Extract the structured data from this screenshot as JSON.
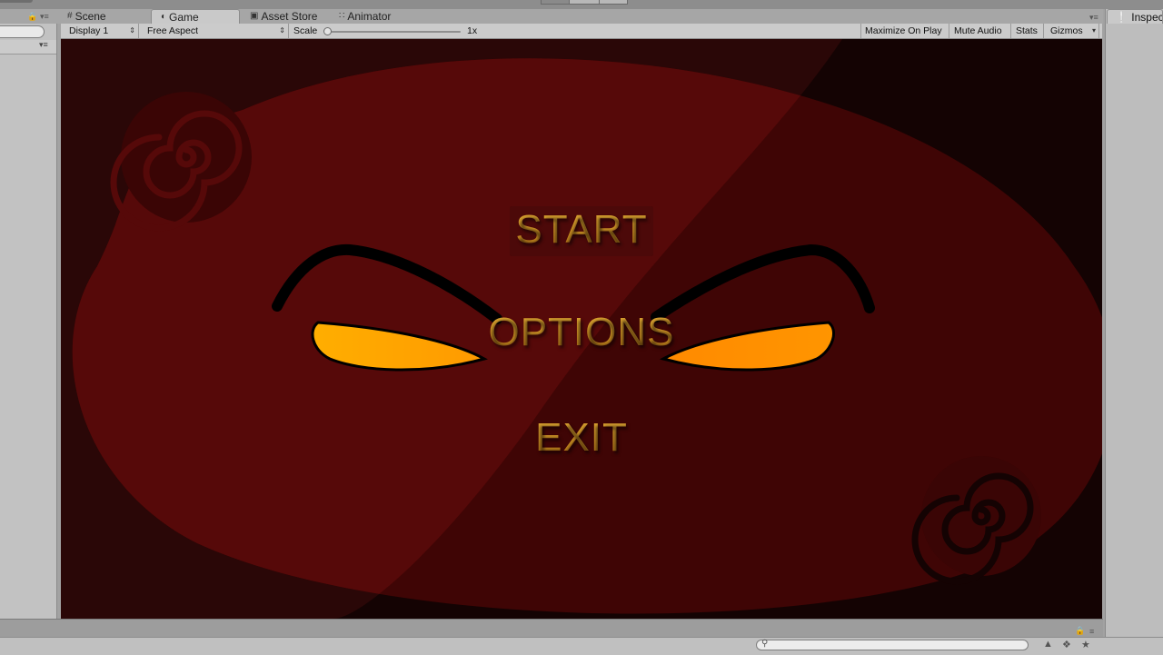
{
  "tabs": [
    {
      "label": "Scene",
      "icon": "grid-icon"
    },
    {
      "label": "Game",
      "icon": "pacman-icon",
      "active": true
    },
    {
      "label": "Asset Store",
      "icon": "store-icon"
    },
    {
      "label": "Animator",
      "icon": "animator-icon"
    }
  ],
  "inspector_tab": "Inspector",
  "toolbar": {
    "display": "Display 1",
    "aspect": "Free Aspect",
    "scale_label": "Scale",
    "scale_value": "1x",
    "maximize": "Maximize On Play",
    "mute": "Mute Audio",
    "stats": "Stats",
    "gizmos": "Gizmos"
  },
  "game_menu": {
    "start": "START",
    "options": "OPTIONS",
    "exit": "EXIT"
  },
  "colors": {
    "background_dark": "#140303",
    "ellipse_red": "#4f0909",
    "eye_orange": "#ffa100",
    "menu_gold": "#d29a2a"
  }
}
